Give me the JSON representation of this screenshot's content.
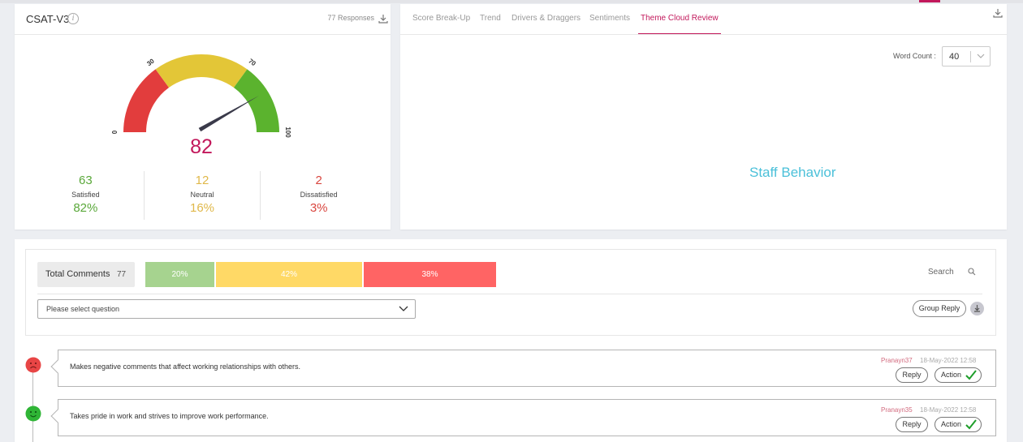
{
  "csat": {
    "title": "CSAT-V3",
    "info_icon": "i",
    "responses": "77 Responses",
    "score": "82",
    "gauge": {
      "ticks": [
        "0",
        "30",
        "70",
        "100"
      ],
      "min": 0,
      "max": 100,
      "value": 82,
      "bands": [
        {
          "from": 0,
          "to": 30,
          "color": "#e23d3d"
        },
        {
          "from": 30,
          "to": 70,
          "color": "#e3c637"
        },
        {
          "from": 70,
          "to": 100,
          "color": "#5bb32e"
        }
      ]
    },
    "stats": [
      {
        "count": "63",
        "label": "Satisfied",
        "pct": "82%",
        "color": "#5aa83a"
      },
      {
        "count": "12",
        "label": "Neutral",
        "pct": "16%",
        "color": "#e0b84a"
      },
      {
        "count": "2",
        "label": "Dissatisfied",
        "pct": "3%",
        "color": "#d9463f"
      }
    ]
  },
  "tabs": [
    "Score Break-Up",
    "Trend",
    "Drivers & Draggers",
    "Sentiments",
    "Theme Cloud Review"
  ],
  "active_tab": "Theme Cloud Review",
  "word_count": {
    "label": "Word Count :",
    "value": "40"
  },
  "cloud_words": [
    "Staff Behavior"
  ],
  "comments_panel": {
    "total_label": "Total Comments",
    "total_count": "77",
    "segments": [
      {
        "label": "20%",
        "value": 20,
        "color": "#a6d38f"
      },
      {
        "label": "42%",
        "value": 42,
        "color": "#ffd966"
      },
      {
        "label": "38%",
        "value": 38,
        "color": "#ff6464"
      }
    ],
    "search_label": "Search",
    "question_placeholder": "Please select question",
    "group_reply_label": "Group Reply"
  },
  "comments": [
    {
      "sentiment": "negative",
      "text": "Makes negative comments that affect working relationships with others.",
      "user": "Pranayn37",
      "date": "18-May-2022 12:58",
      "reply_label": "Reply",
      "action_label": "Action"
    },
    {
      "sentiment": "positive",
      "text": "Takes pride in work and strives to improve work performance.",
      "user": "Pranayn35",
      "date": "18-May-2022 12:58",
      "reply_label": "Reply",
      "action_label": "Action"
    }
  ],
  "colors": {
    "accent": "#c2185b",
    "cloud": "#4bc0d9",
    "negative": "#e84545",
    "positive": "#2fb536"
  }
}
